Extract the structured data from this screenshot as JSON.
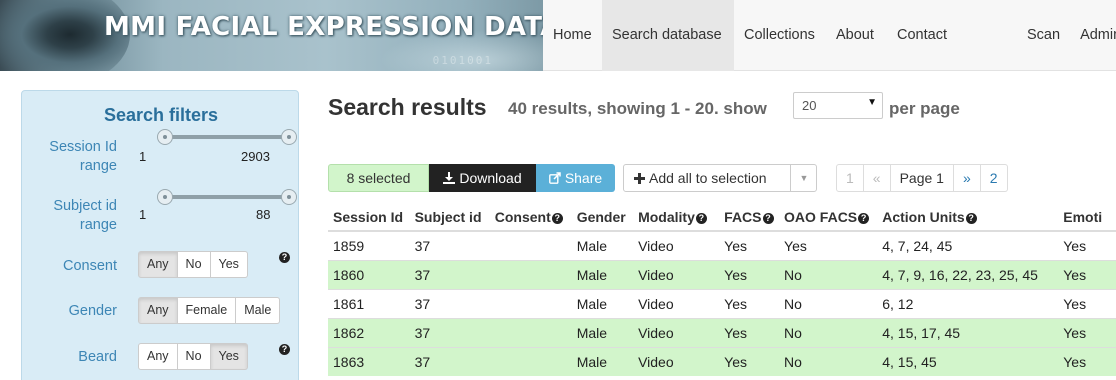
{
  "header": {
    "title": "MMI FACIAL EXPRESSION DATABASE",
    "banner_binary": "0101001",
    "nav": [
      "Home",
      "Search database",
      "Collections",
      "About",
      "Contact"
    ],
    "nav_right": [
      "Scan",
      "Admin"
    ]
  },
  "sidebar": {
    "title": "Search filters",
    "session_id": {
      "label_line1": "Session Id",
      "label_line2": "range",
      "min": "1",
      "max": "2903"
    },
    "subject_id": {
      "label_line1": "Subject id",
      "label_line2": "range",
      "min": "1",
      "max": "88"
    },
    "consent": {
      "label": "Consent",
      "options": [
        "Any",
        "No",
        "Yes"
      ],
      "selected": "Any"
    },
    "gender": {
      "label": "Gender",
      "options": [
        "Any",
        "Female",
        "Male"
      ],
      "selected": "Any"
    },
    "beard": {
      "label": "Beard",
      "options": [
        "Any",
        "No",
        "Yes"
      ],
      "selected": "Yes"
    },
    "help_glyph": "?"
  },
  "main": {
    "title": "Search results",
    "info": "40 results, showing 1 - 20. show",
    "per_page_value": "20",
    "per_page_label": "per page",
    "selected_label": "8 selected",
    "download_label": "Download",
    "share_label": "Share",
    "add_all_label": "Add all to selection",
    "pager": {
      "first": "1",
      "prev": "«",
      "current": "Page 1",
      "next": "»",
      "last": "2"
    },
    "columns": [
      "Session Id",
      "Subject id",
      "Consent",
      "Gender",
      "Modality",
      "FACS",
      "OAO FACS",
      "Action Units",
      "Emoti"
    ],
    "rows": [
      {
        "session": "1859",
        "subject": "37",
        "consent": "",
        "gender": "Male",
        "modality": "Video",
        "facs": "Yes",
        "oao": "Yes",
        "aus": "4, 7, 24, 45",
        "emotion": "Yes",
        "selected": false
      },
      {
        "session": "1860",
        "subject": "37",
        "consent": "",
        "gender": "Male",
        "modality": "Video",
        "facs": "Yes",
        "oao": "No",
        "aus": "4, 7, 9, 16, 22, 23, 25, 45",
        "emotion": "Yes",
        "selected": true
      },
      {
        "session": "1861",
        "subject": "37",
        "consent": "",
        "gender": "Male",
        "modality": "Video",
        "facs": "Yes",
        "oao": "No",
        "aus": "6, 12",
        "emotion": "Yes",
        "selected": false
      },
      {
        "session": "1862",
        "subject": "37",
        "consent": "",
        "gender": "Male",
        "modality": "Video",
        "facs": "Yes",
        "oao": "No",
        "aus": "4, 15, 17, 45",
        "emotion": "Yes",
        "selected": true
      },
      {
        "session": "1863",
        "subject": "37",
        "consent": "",
        "gender": "Male",
        "modality": "Video",
        "facs": "Yes",
        "oao": "No",
        "aus": "4, 15, 45",
        "emotion": "Yes",
        "selected": true
      }
    ]
  },
  "colors": {
    "selected_row": "#d2f5cb",
    "sidebar_bg": "#d9ecf6",
    "accent_blue": "#2a6f9b",
    "share_btn": "#5bb0d8"
  }
}
